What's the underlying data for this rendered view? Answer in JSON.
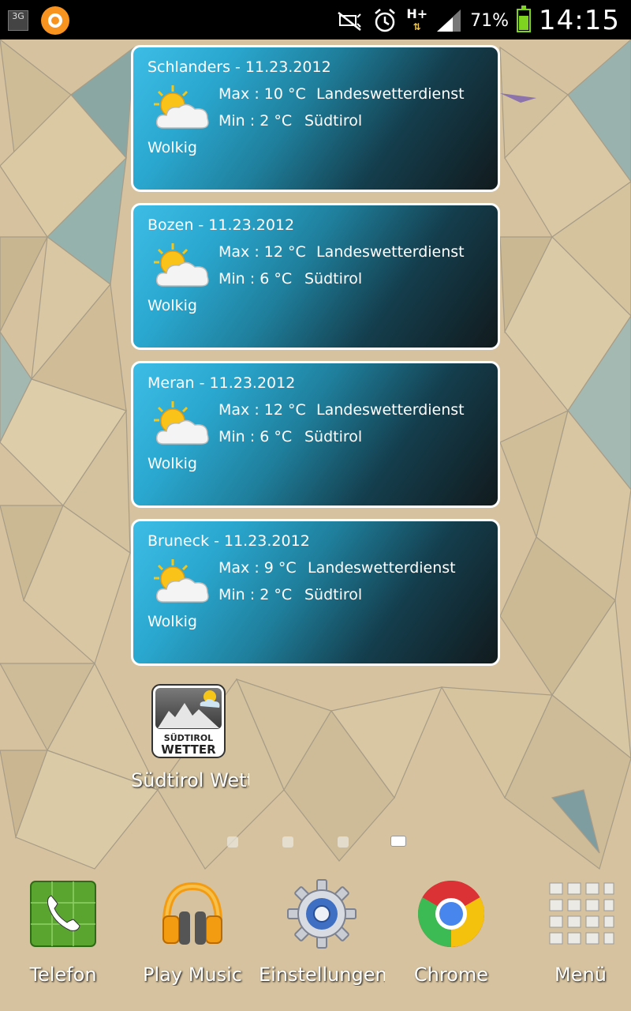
{
  "status_bar": {
    "network_type": "3G",
    "data_type": "H+",
    "battery_percent": "71%",
    "battery_level": 0.71,
    "time": "14:15",
    "icons": [
      "3g-icon",
      "app-notification-icon",
      "mute-icon",
      "alarm-icon",
      "h-plus-data-icon",
      "signal-icon",
      "battery-icon"
    ]
  },
  "widgets": [
    {
      "title": "Schlanders - 11.23.2012",
      "max": "Max : 10 °C",
      "min": "Min : 2 °C",
      "source_line1": "Landeswetterdienst",
      "source_line2": "Südtirol",
      "condition": "Wolkig",
      "icon": "partly-cloudy-icon"
    },
    {
      "title": "Bozen - 11.23.2012",
      "max": "Max : 12 °C",
      "min": "Min : 6 °C",
      "source_line1": "Landeswetterdienst",
      "source_line2": "Südtirol",
      "condition": "Wolkig",
      "icon": "partly-cloudy-icon"
    },
    {
      "title": "Meran - 11.23.2012",
      "max": "Max : 12 °C",
      "min": "Min : 6 °C",
      "source_line1": "Landeswetterdienst",
      "source_line2": "Südtirol",
      "condition": "Wolkig",
      "icon": "partly-cloudy-icon"
    },
    {
      "title": "Bruneck - 11.23.2012",
      "max": "Max : 9 °C",
      "min": "Min : 2 °C",
      "source_line1": "Landeswetterdienst",
      "source_line2": "Südtirol",
      "condition": "Wolkig",
      "icon": "partly-cloudy-icon"
    }
  ],
  "home_app": {
    "label": "Südtirol Wett",
    "logo_line1": "SÜDTIROL",
    "logo_line2": "WETTER"
  },
  "pager": {
    "pages": 4,
    "active_index": 3
  },
  "dock": [
    {
      "label": "Telefon",
      "icon": "phone-icon"
    },
    {
      "label": "Play Music",
      "icon": "headphones-icon"
    },
    {
      "label": "Einstellungen",
      "icon": "settings-gear-icon"
    },
    {
      "label": "Chrome",
      "icon": "chrome-icon"
    },
    {
      "label": "Menü",
      "icon": "app-grid-icon"
    }
  ],
  "colors": {
    "widget_gradient_start": "#3dbde6",
    "widget_gradient_end": "#111a1d",
    "wallpaper_base": "#d6c29e",
    "battery": "#7ed321"
  }
}
